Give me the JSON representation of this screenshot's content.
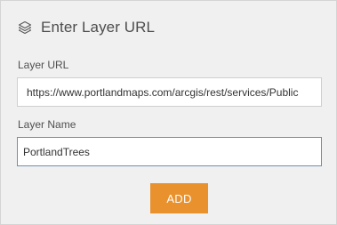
{
  "header": {
    "icon": "layers-icon",
    "title": "Enter Layer URL"
  },
  "form": {
    "url_label": "Layer URL",
    "url_value": "https://www.portlandmaps.com/arcgis/rest/services/Public",
    "name_label": "Layer Name",
    "name_value": "PortlandTrees"
  },
  "actions": {
    "add_label": "ADD"
  },
  "colors": {
    "accent": "#e8912d",
    "panel_background": "#f0f0f0",
    "focused_border": "#6f8fb0"
  }
}
